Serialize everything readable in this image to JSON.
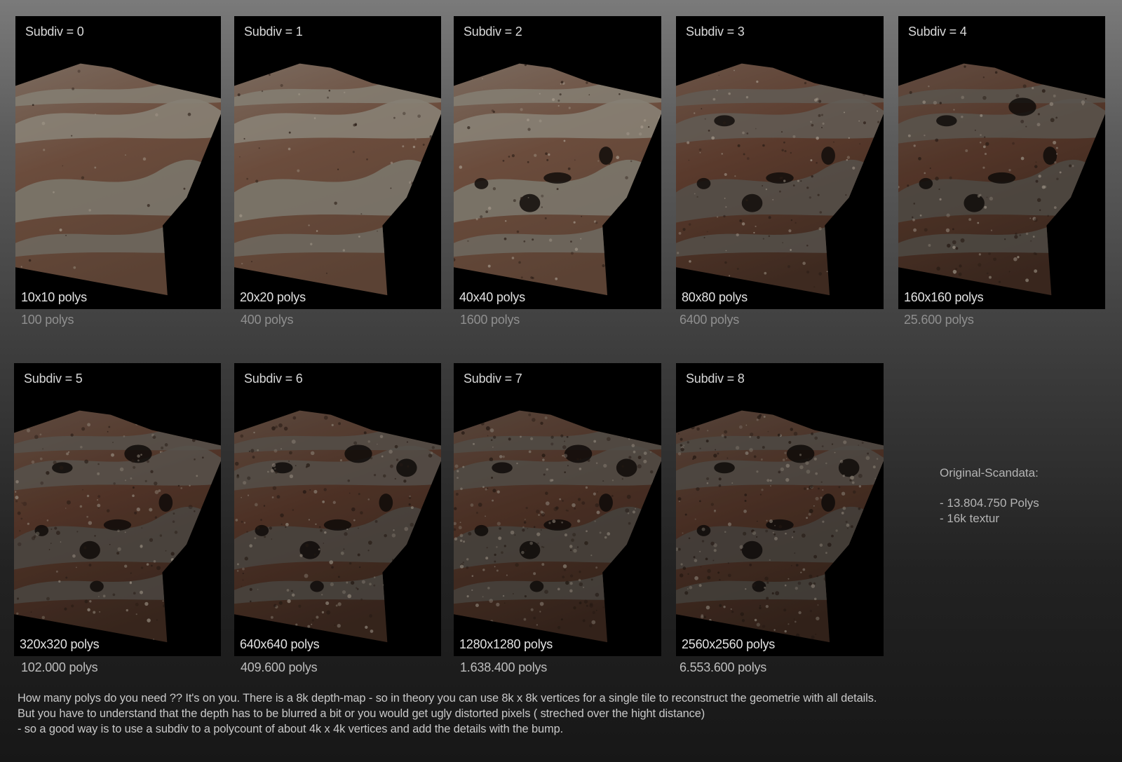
{
  "panels": [
    {
      "subdiv": "Subdiv = 0",
      "grid": "10x10 polys",
      "count": "100 polys",
      "detail": 0
    },
    {
      "subdiv": "Subdiv = 1",
      "grid": "20x20 polys",
      "count": "400 polys",
      "detail": 1
    },
    {
      "subdiv": "Subdiv = 2",
      "grid": "40x40 polys",
      "count": "1600 polys",
      "detail": 2
    },
    {
      "subdiv": "Subdiv = 3",
      "grid": "80x80 polys",
      "count": "6400 polys",
      "detail": 3
    },
    {
      "subdiv": "Subdiv = 4",
      "grid": "160x160 polys",
      "count": "25.600 polys",
      "detail": 4
    },
    {
      "subdiv": "Subdiv = 5",
      "grid": "320x320 polys",
      "count": "102.000 polys",
      "detail": 5
    },
    {
      "subdiv": "Subdiv = 6",
      "grid": "640x640 polys",
      "count": "409.600 polys",
      "detail": 6
    },
    {
      "subdiv": "Subdiv = 7",
      "grid": "1280x1280 polys",
      "count": "1.638.400 polys",
      "detail": 7
    },
    {
      "subdiv": "Subdiv = 8",
      "grid": "2560x2560 polys",
      "count": "6.553.600 polys",
      "detail": 8
    }
  ],
  "side_note": {
    "title": "Original-Scandata:",
    "line1": "- 13.804.750 Polys",
    "line2": "- 16k textur"
  },
  "footer": {
    "line1": "How many polys do you need ?? It's on you. There is a 8k depth-map - so in theory you can use 8k x 8k vertices for a single tile to reconstruct the geometrie with all details.",
    "line2": "But you have to understand that the depth has to be blurred a bit or you would get ugly distorted pixels ( streched over the hight distance)",
    "line3": "- so a good way is to use a subdiv to a polycount of about 4k x 4k vertices and add the details with the bump."
  }
}
